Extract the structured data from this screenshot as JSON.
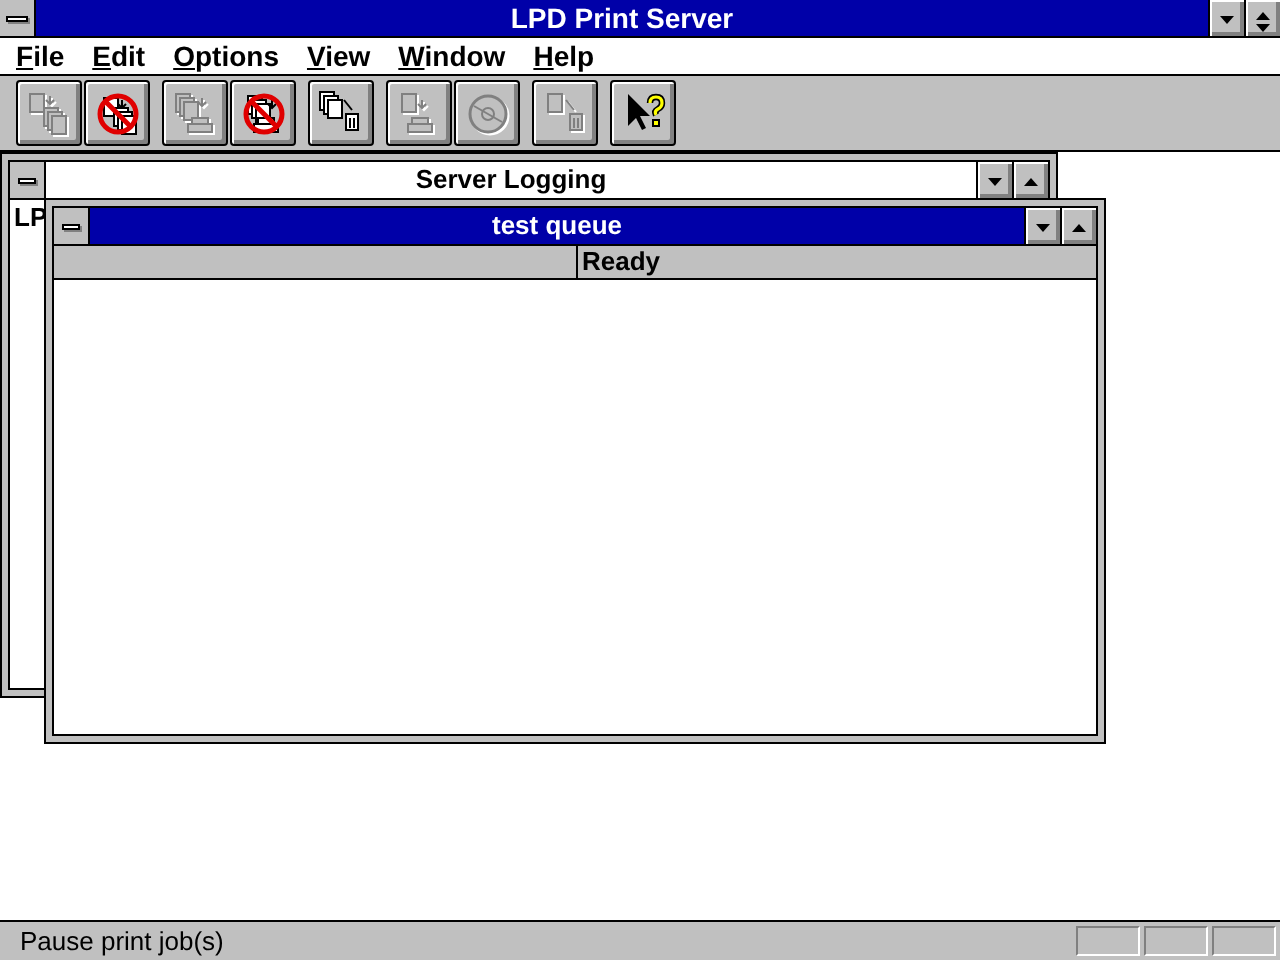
{
  "app": {
    "title": "LPD Print Server"
  },
  "menu": [
    {
      "label": "File"
    },
    {
      "label": "Edit"
    },
    {
      "label": "Options"
    },
    {
      "label": "View"
    },
    {
      "label": "Window"
    },
    {
      "label": "Help"
    }
  ],
  "toolbar_groups": [
    [
      {
        "kind": "move-docs",
        "disabled": true
      },
      {
        "kind": "stop-docs",
        "disabled": false
      }
    ],
    [
      {
        "kind": "print-docs",
        "disabled": true
      },
      {
        "kind": "stop-print",
        "disabled": false
      }
    ],
    [
      {
        "kind": "delete-docs",
        "disabled": false
      }
    ],
    [
      {
        "kind": "print-doc",
        "disabled": true
      },
      {
        "kind": "disc",
        "disabled": true
      }
    ],
    [
      {
        "kind": "delete-doc",
        "disabled": true
      }
    ],
    [
      {
        "kind": "help",
        "disabled": false
      }
    ]
  ],
  "windows": [
    {
      "kind": "log",
      "title": "Server Logging",
      "active": false,
      "lines": [
        "LP"
      ]
    },
    {
      "kind": "queue",
      "title": "test queue",
      "active": true,
      "header_cells": [
        "Ready"
      ]
    }
  ],
  "status_bar": {
    "text": "Pause print job(s)"
  }
}
